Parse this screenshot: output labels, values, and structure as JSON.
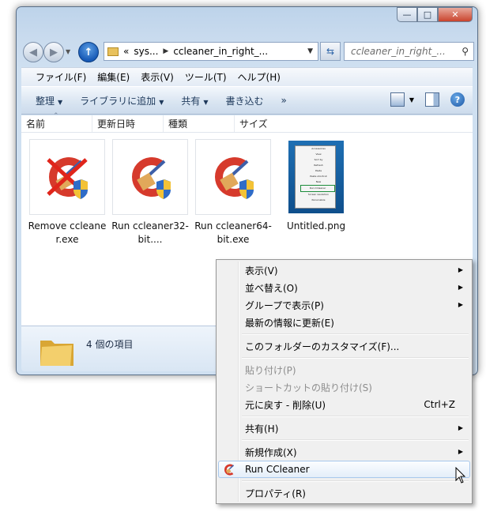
{
  "window": {
    "address": {
      "overflow": "«",
      "segment1": "sys...",
      "segment2": "ccleaner_in_right_..."
    },
    "search_placeholder": "ccleaner_in_right_...",
    "menu": [
      "ファイル(F)",
      "編集(E)",
      "表示(V)",
      "ツール(T)",
      "ヘルプ(H)"
    ],
    "toolbar": [
      {
        "label": "整理",
        "has_dropdown": true
      },
      {
        "label": "ライブラリに追加",
        "has_dropdown": true
      },
      {
        "label": "共有",
        "has_dropdown": true
      },
      {
        "label": "書き込む",
        "has_dropdown": false
      },
      {
        "label": "»",
        "has_dropdown": false
      }
    ],
    "columns": [
      "名前",
      "更新日時",
      "種類",
      "サイズ"
    ],
    "files": [
      {
        "name": "Remove ccleaner.exe",
        "icon": "ccleaner-remove-icon"
      },
      {
        "name": "Run ccleaner32-bit....",
        "icon": "ccleaner-icon"
      },
      {
        "name": "Run ccleaner64-bit.exe",
        "icon": "ccleaner-icon"
      },
      {
        "name": "Untitled.png",
        "icon": "screenshot-thumbnail"
      }
    ],
    "status_count": "4 個の項目"
  },
  "context_menu": {
    "items": [
      {
        "label": "表示(V)",
        "submenu": true
      },
      {
        "label": "並べ替え(O)",
        "submenu": true
      },
      {
        "label": "グループで表示(P)",
        "submenu": true
      },
      {
        "label": "最新の情報に更新(E)"
      },
      {
        "label": "このフォルダーのカスタマイズ(F)..."
      },
      {
        "label": "貼り付け(P)",
        "disabled": true
      },
      {
        "label": "ショートカットの貼り付け(S)",
        "disabled": true
      },
      {
        "label": "元に戻す - 削除(U)",
        "accel": "Ctrl+Z"
      },
      {
        "label": "共有(H)",
        "submenu": true
      },
      {
        "label": "新規作成(X)",
        "submenu": true
      },
      {
        "label": "Run CCleaner",
        "highlighted": true,
        "icon": "ccleaner-icon"
      },
      {
        "label": "プロパティ(R)"
      }
    ]
  },
  "thumbnail_menu": [
    "Accessories",
    "View",
    "Sort by",
    "Refresh",
    "Paste",
    "Paste shortcut",
    "New",
    "Run CCleaner",
    "Screen resolution",
    "Personalize"
  ],
  "colors": {
    "accent": "#1b56a4",
    "ccleaner_red": "#d63a2c",
    "menu_highlight": "#a8c8ec"
  }
}
